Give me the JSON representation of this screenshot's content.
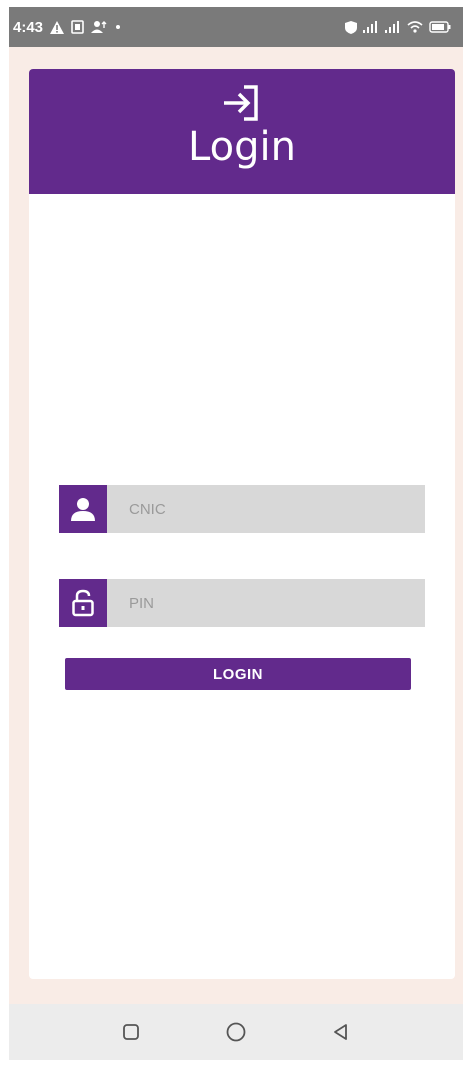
{
  "status_bar": {
    "time": "4:43",
    "icons": [
      "warning-icon",
      "sim-icon",
      "person-upload-icon",
      "dot-icon"
    ],
    "right_icons": [
      "shield-icon",
      "signal-icon",
      "signal-icon",
      "wifi-icon",
      "battery-icon"
    ]
  },
  "header": {
    "icon": "login-icon",
    "title": "Login",
    "color": "#622a8c"
  },
  "form": {
    "cnic": {
      "icon": "person-icon",
      "placeholder": "CNIC",
      "value": ""
    },
    "pin": {
      "icon": "lock-icon",
      "placeholder": "PIN",
      "value": ""
    },
    "login_label": "LOGIN"
  },
  "nav_bar": {
    "icons": [
      "square-icon",
      "circle-icon",
      "triangle-back-icon"
    ]
  },
  "colors": {
    "primary": "#622a8c",
    "background": "#f9ece6",
    "input_bg": "#d8d8d8"
  }
}
